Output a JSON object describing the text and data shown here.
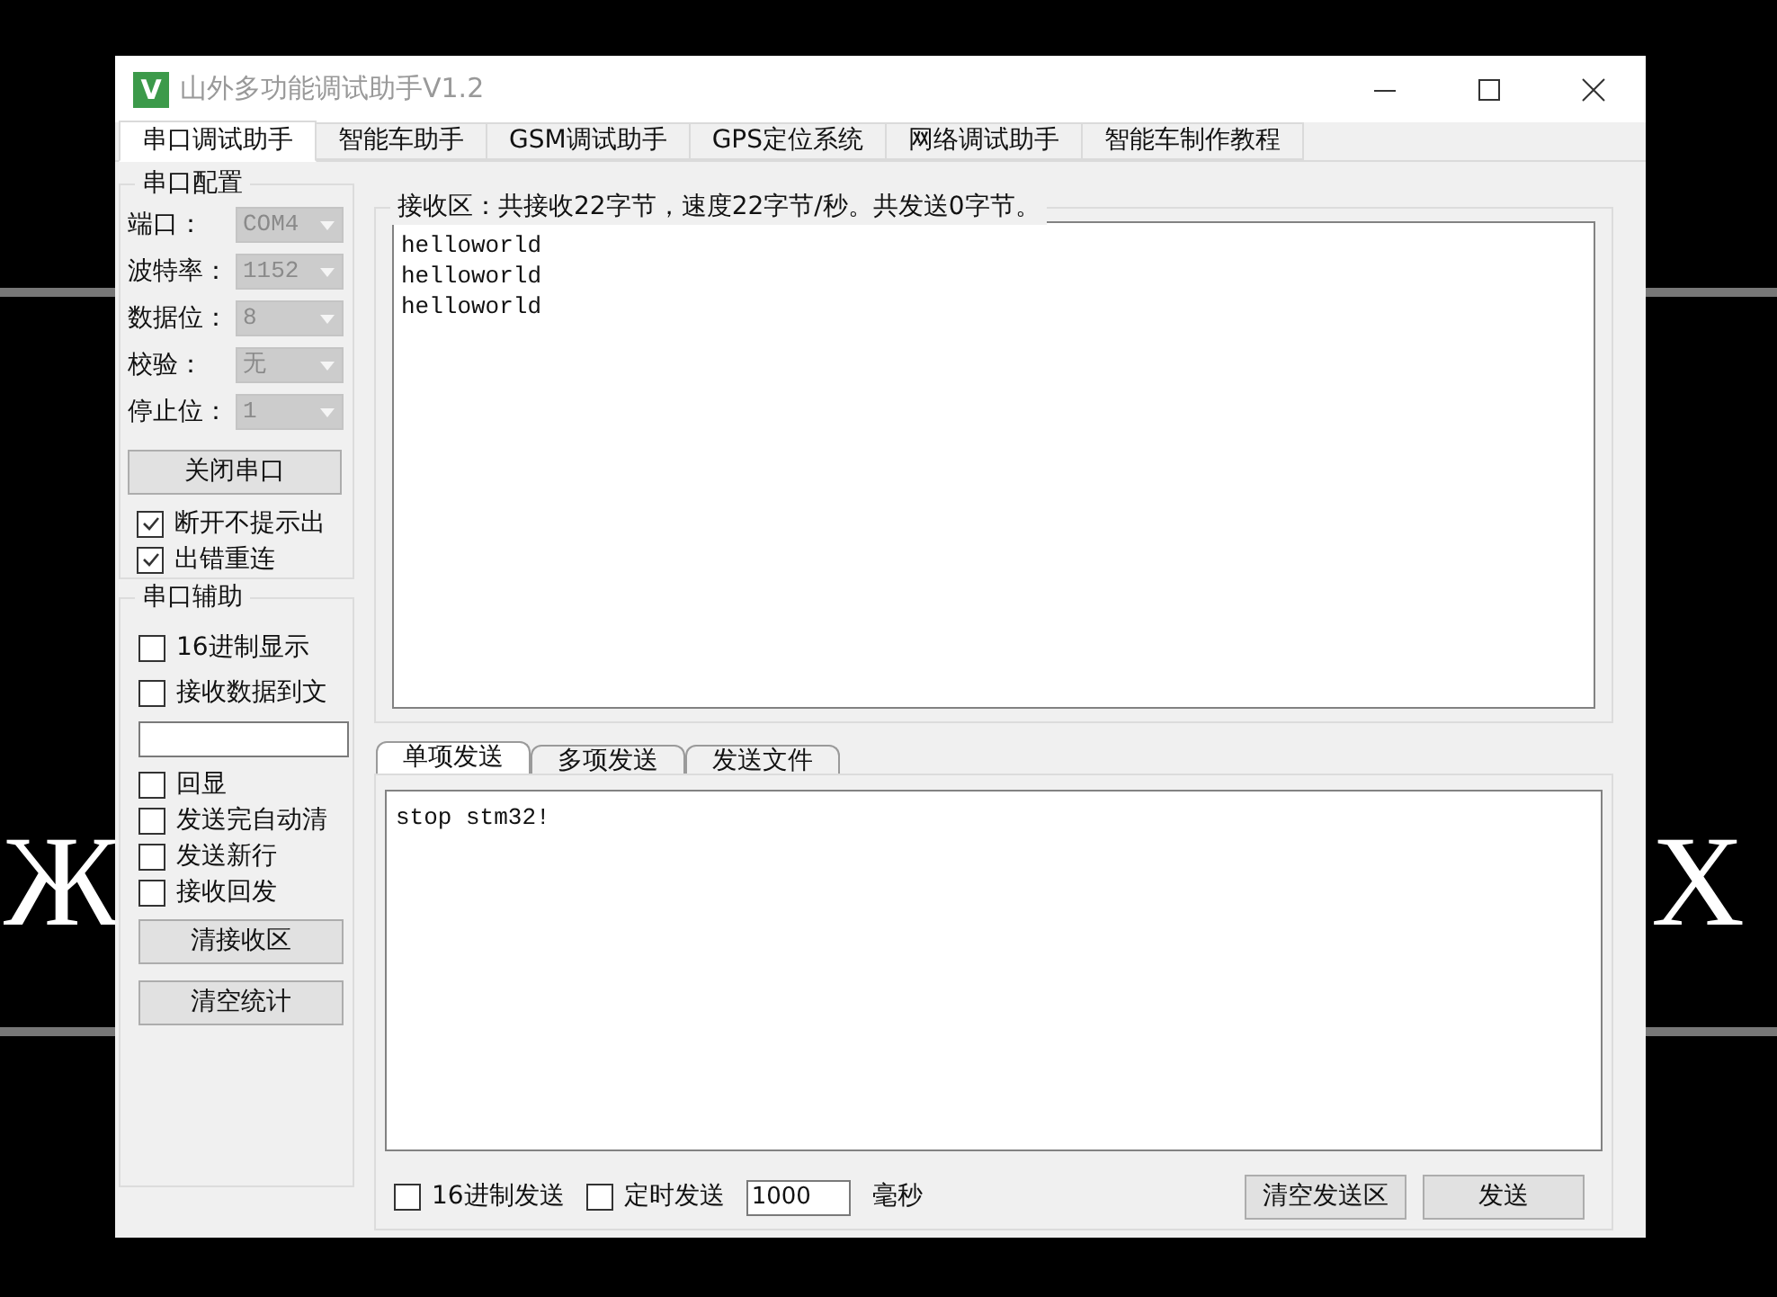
{
  "background": {
    "letters": [
      "Ж",
      "X"
    ]
  },
  "window": {
    "icon_letter": "V",
    "title": "山外多功能调试助手V1.2"
  },
  "tabs": [
    {
      "label": "串口调试助手",
      "selected": true
    },
    {
      "label": "智能车助手",
      "selected": false
    },
    {
      "label": "GSM调试助手",
      "selected": false
    },
    {
      "label": "GPS定位系统",
      "selected": false
    },
    {
      "label": "网络调试助手",
      "selected": false
    },
    {
      "label": "智能车制作教程",
      "selected": false
    }
  ],
  "port_config": {
    "title": "串口配置",
    "fields": [
      {
        "label": "端口：",
        "value": "COM4",
        "disabled": true
      },
      {
        "label": "波特率：",
        "value": "1152",
        "disabled": true
      },
      {
        "label": "数据位：",
        "value": "8",
        "disabled": true
      },
      {
        "label": "校验：",
        "value": "无",
        "disabled": true
      },
      {
        "label": "停止位：",
        "value": "1",
        "disabled": true
      }
    ],
    "button": "关闭串口",
    "options": [
      {
        "label": "断开不提示出",
        "checked": true
      },
      {
        "label": "出错重连",
        "checked": true
      }
    ]
  },
  "port_assist": {
    "title": "串口辅助",
    "options_top": [
      {
        "label": "16进制显示",
        "checked": false
      },
      {
        "label": "接收数据到文",
        "checked": false
      }
    ],
    "options": [
      {
        "label": "回显",
        "checked": false
      },
      {
        "label": "发送完自动清",
        "checked": false
      },
      {
        "label": "发送新行",
        "checked": false
      },
      {
        "label": "接收回发",
        "checked": false
      }
    ],
    "buttons": [
      "清接收区",
      "清空统计"
    ]
  },
  "receive": {
    "title": "接收区：共接收22字节，速度22字节/秒。共发送0字节。",
    "lines": [
      "helloworld",
      "helloworld",
      "helloworld"
    ]
  },
  "send_tabs": [
    {
      "label": "单项发送",
      "selected": true
    },
    {
      "label": "多项发送",
      "selected": false
    },
    {
      "label": "发送文件",
      "selected": false
    }
  ],
  "send": {
    "text": "stop stm32!",
    "options": [
      {
        "label": "16进制发送",
        "checked": false
      },
      {
        "label": "定时发送",
        "checked": false
      }
    ],
    "interval": "1000",
    "unit": "毫秒",
    "buttons": [
      "清空发送区",
      "发送"
    ]
  }
}
